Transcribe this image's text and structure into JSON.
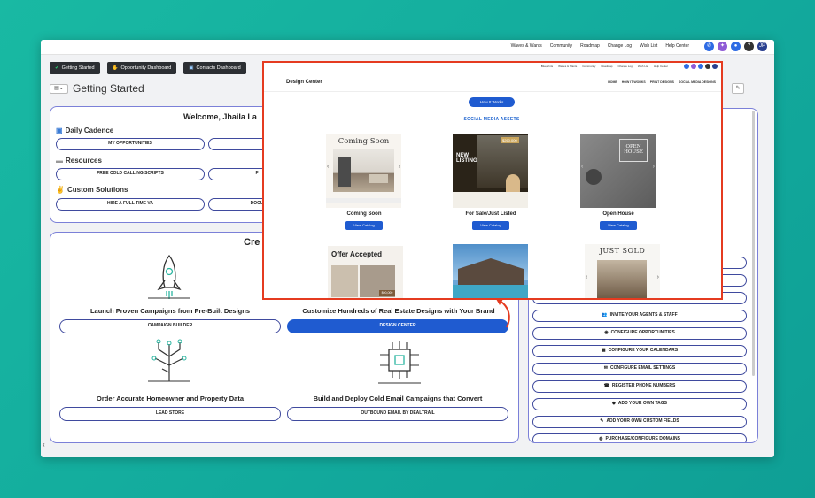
{
  "topnav": [
    "Waves & Wants",
    "Community",
    "Roadmap",
    "Change Log",
    "Wish List",
    "Help Center"
  ],
  "topicons": {
    "avatar": "JP",
    "help": "?"
  },
  "tabs": [
    "Getting Started",
    "Opportunity Dashboard",
    "Contacts Dashboard"
  ],
  "page_title": "Getting Started",
  "welcome": {
    "title": "Welcome, Jhaila La",
    "daily_cadence": "Daily Cadence",
    "my_opps": "MY OPPORTUNITIES",
    "resources": "Resources",
    "free_scripts": "FREE COLD CALLING SCRIPTS",
    "custom": "Custom Solutions",
    "hire_va": "HIRE A FULL TIME VA",
    "docu": "DOCU",
    "fr": "F"
  },
  "create": {
    "title": "Cre",
    "f1": "Launch Proven Campaigns from Pre-Built Designs",
    "f2": "Customize Hundreds of Real Estate Designs with Your Brand",
    "f3": "Order Accurate Homeowner and Property Data",
    "f4": "Build and Deploy Cold Email Campaigns that Convert",
    "b1": "CAMPAIGN BUILDER",
    "b2": "DESIGN CENTER",
    "b3": "LEAD STORE",
    "b4": "OUTBOUND EMAIL BY DEALTRAIL"
  },
  "side_buttons": [
    "INVITE YOUR AGENTS & STAFF",
    "CONFIGURE OPPORTUNITIES",
    "CONFIGURE YOUR CALENDARS",
    "CONFIGURE EMAIL SETTINGS",
    "REGISTER PHONE NUMBERS",
    "ADD YOUR OWN TAGS",
    "ADD YOUR OWN CUSTOM FIELDS",
    "PURCHASE/CONFIGURE DOMAINS"
  ],
  "overlay": {
    "title": "Design Center",
    "nav": [
      "HOME",
      "HOW IT WORKS",
      "PRINT DESIGNS",
      "SOCIAL MEDIA DESIGNS"
    ],
    "topnav": [
      "Blueprints",
      "Waves & Wants",
      "Community",
      "Roadmap",
      "Change Log",
      "Wish List",
      "Help Center"
    ],
    "how_it_works": "How It Works",
    "section": "SOCIAL MEDIA ASSETS",
    "cards": [
      {
        "label": "Coming Soon",
        "img_text": "Coming Soon"
      },
      {
        "label": "For Sale/Just Listed",
        "img_text": "NEW LISTING",
        "price": "$260,000"
      },
      {
        "label": "Open House",
        "img_text": "OPEN HOUSE"
      }
    ],
    "row2": [
      {
        "img_text": "Offer Accepted"
      },
      {
        "img_text": ""
      },
      {
        "img_text": "JUST SOLD"
      }
    ],
    "view_catalog": "View Catalog"
  },
  "colors": {
    "accent": "#1f5bd0",
    "panel_border": "#7b80d8",
    "highlight": "#e53b20",
    "bg": "#17b3a0"
  }
}
